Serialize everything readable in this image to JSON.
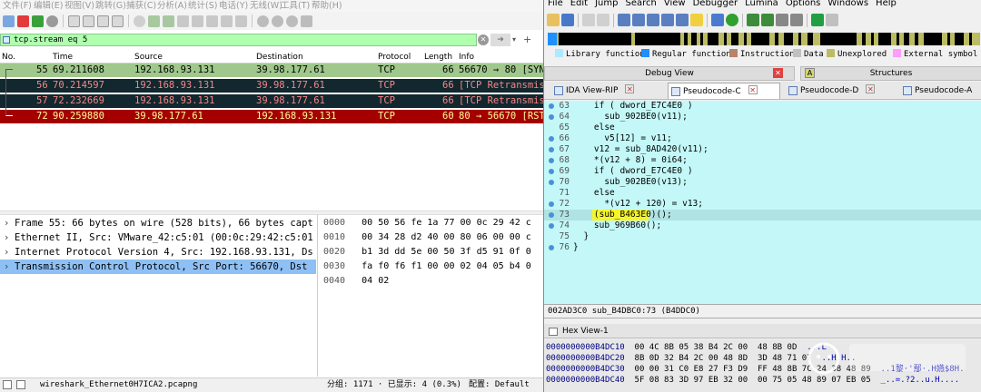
{
  "wireshark": {
    "menu": [
      "文件(F)",
      "编辑(E)",
      "视图(V)",
      "跳转(G)",
      "捕获(C)",
      "分析(A)",
      "统计(S)",
      "电话(Y)",
      "无线(W)",
      "工具(T)",
      "帮助(H)"
    ],
    "filter_value": "tcp.stream eq 5",
    "columns": [
      "No.",
      "Time",
      "Source",
      "Destination",
      "Protocol",
      "Length",
      "Info"
    ],
    "packets": [
      {
        "no": "55",
        "time": "69.211608",
        "src": "192.168.93.131",
        "dst": "39.98.177.61",
        "proto": "TCP",
        "len": "66",
        "info": "56670 → 80 [SYN",
        "bg": "#a0c88c",
        "fg": "#000000"
      },
      {
        "no": "56",
        "time": "70.214597",
        "src": "192.168.93.131",
        "dst": "39.98.177.61",
        "proto": "TCP",
        "len": "66",
        "info": "[TCP Retransmis",
        "bg": "#12272e",
        "fg": "#f78787"
      },
      {
        "no": "57",
        "time": "72.232669",
        "src": "192.168.93.131",
        "dst": "39.98.177.61",
        "proto": "TCP",
        "len": "66",
        "info": "[TCP Retransmis",
        "bg": "#12272e",
        "fg": "#f78787"
      },
      {
        "no": "72",
        "time": "90.259880",
        "src": "39.98.177.61",
        "dst": "192.168.93.131",
        "proto": "TCP",
        "len": "60",
        "info": "80 → 56670 [RST",
        "bg": "#a40000",
        "fg": "#fffc9c"
      }
    ],
    "details": [
      "Frame 55: 66 bytes on wire (528 bits), 66 bytes capt",
      "Ethernet II, Src: VMware_42:c5:01 (00:0c:29:42:c5:01",
      "Internet Protocol Version 4, Src: 192.168.93.131, Ds",
      "Transmission Control Protocol, Src Port: 56670, Dst"
    ],
    "hex_rows": [
      {
        "off": "0000",
        "bytes": "00 50 56 fe 1a 77 00 0c  29 42 c"
      },
      {
        "off": "0010",
        "bytes": "00 34 28 d2 40 00 80 06  00 00 c"
      },
      {
        "off": "0020",
        "bytes": "b1 3d dd 5e 00 50 3f d5  91 0f 0"
      },
      {
        "off": "0030",
        "bytes": "fa f0 f6 f1 00 00 02 04  05 b4 0"
      },
      {
        "off": "0040",
        "bytes": "04 02"
      }
    ],
    "status": {
      "file": "wireshark_Ethernet0H7ICA2.pcapng",
      "groups": "分组: 1171 · 已显示: 4 (0.3%)",
      "profile": "配置: Default"
    }
  },
  "ida": {
    "menu": [
      "File",
      "Edit",
      "Jump",
      "Search",
      "View",
      "Debugger",
      "Lumina",
      "Options",
      "Windows",
      "Help"
    ],
    "legend": [
      {
        "label": "Library function",
        "color": "#aee9ff"
      },
      {
        "label": "Regular function",
        "color": "#1e90ff"
      },
      {
        "label": "Instruction",
        "color": "#b9826a"
      },
      {
        "label": "Data",
        "color": "#c0c0c0"
      },
      {
        "label": "Unexplored",
        "color": "#bcbc64"
      },
      {
        "label": "External symbol",
        "color": "#ff9cff"
      }
    ],
    "top_tabs": [
      "Debug View",
      "Structures"
    ],
    "tabs": [
      "IDA View-RIP",
      "Pseudocode-C",
      "Pseudocode-D",
      "Pseudocode-A"
    ],
    "code_lines": [
      {
        "n": "63",
        "dot": true,
        "text": "    if ( dword_E7C4E0 )"
      },
      {
        "n": "64",
        "dot": true,
        "text": "      sub_902BE0(v11);"
      },
      {
        "n": "65",
        "dot": false,
        "text": "    else"
      },
      {
        "n": "66",
        "dot": true,
        "text": "      v5[12] = v11;"
      },
      {
        "n": "67",
        "dot": true,
        "text": "    v12 = sub_8AD420(v11);"
      },
      {
        "n": "68",
        "dot": true,
        "text": "    *(v12 + 8) = 0i64;"
      },
      {
        "n": "69",
        "dot": true,
        "text": "    if ( dword_E7C4E0 )"
      },
      {
        "n": "70",
        "dot": true,
        "text": "      sub_902BE0(v13);"
      },
      {
        "n": "71",
        "dot": false,
        "text": "    else"
      },
      {
        "n": "72",
        "dot": true,
        "text": "      *(v12 + 120) = v13;"
      },
      {
        "n": "73",
        "dot": true,
        "text": "    (sub_B463E0)();"
      },
      {
        "n": "74",
        "dot": true,
        "text": "    sub_969B60();"
      },
      {
        "n": "75",
        "dot": false,
        "text": "  }"
      },
      {
        "n": "76",
        "dot": true,
        "text": "}"
      }
    ],
    "code_status": "002AD3C0 sub_B4DBC0:73 (B4DDC0)",
    "hex_title": "Hex View-1",
    "hex_rows": [
      {
        "addr": "0000000000B4DC10",
        "bytes": "00 4C 8B 05 38 B4 2C 00  48 8B 0D",
        "ascii": "...L"
      },
      {
        "addr": "0000000000B4DC20",
        "bytes": "8B 0D 32 B4 2C 00 48 8D  3D 48 71 07",
        "ascii": "..H.H.."
      },
      {
        "addr": "0000000000B4DC30",
        "bytes": "00 00 31 C0 E8 27 F3 D9  FF 48 8B 7C 24 38 48 89",
        "ascii": "..1黎·'鄢·.H嬿$8H."
      },
      {
        "addr": "0000000000B4DC40",
        "bytes": "5F 08 83 3D 97 EB 32 00  00 75 05 48 89 07 EB 05",
        "ascii": "_..=.?2..u.H...."
      }
    ]
  }
}
